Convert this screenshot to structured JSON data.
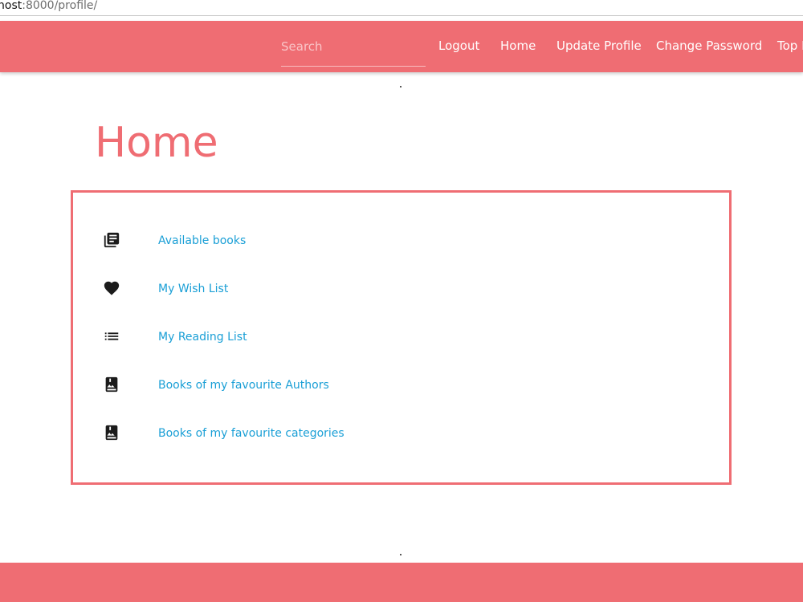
{
  "browser": {
    "url_host": "host",
    "url_rest": ":8000/profile/"
  },
  "colors": {
    "brand": "#ef6d73",
    "link": "#1a9fd6",
    "icon": "#1b1b1b"
  },
  "navbar": {
    "search_placeholder": "Search",
    "links": [
      "Logout",
      "Home",
      "Update Profile",
      "Change Password",
      "Top Rated"
    ]
  },
  "main": {
    "title": "Home",
    "menu": [
      {
        "label": "Available books",
        "icon": "library-books-icon"
      },
      {
        "label": "My Wish List",
        "icon": "heart-icon"
      },
      {
        "label": "My Reading List",
        "icon": "list-icon"
      },
      {
        "label": "Books of my favourite Authors",
        "icon": "book-image-icon"
      },
      {
        "label": "Books of my favourite categories",
        "icon": "book-image-icon"
      }
    ]
  }
}
